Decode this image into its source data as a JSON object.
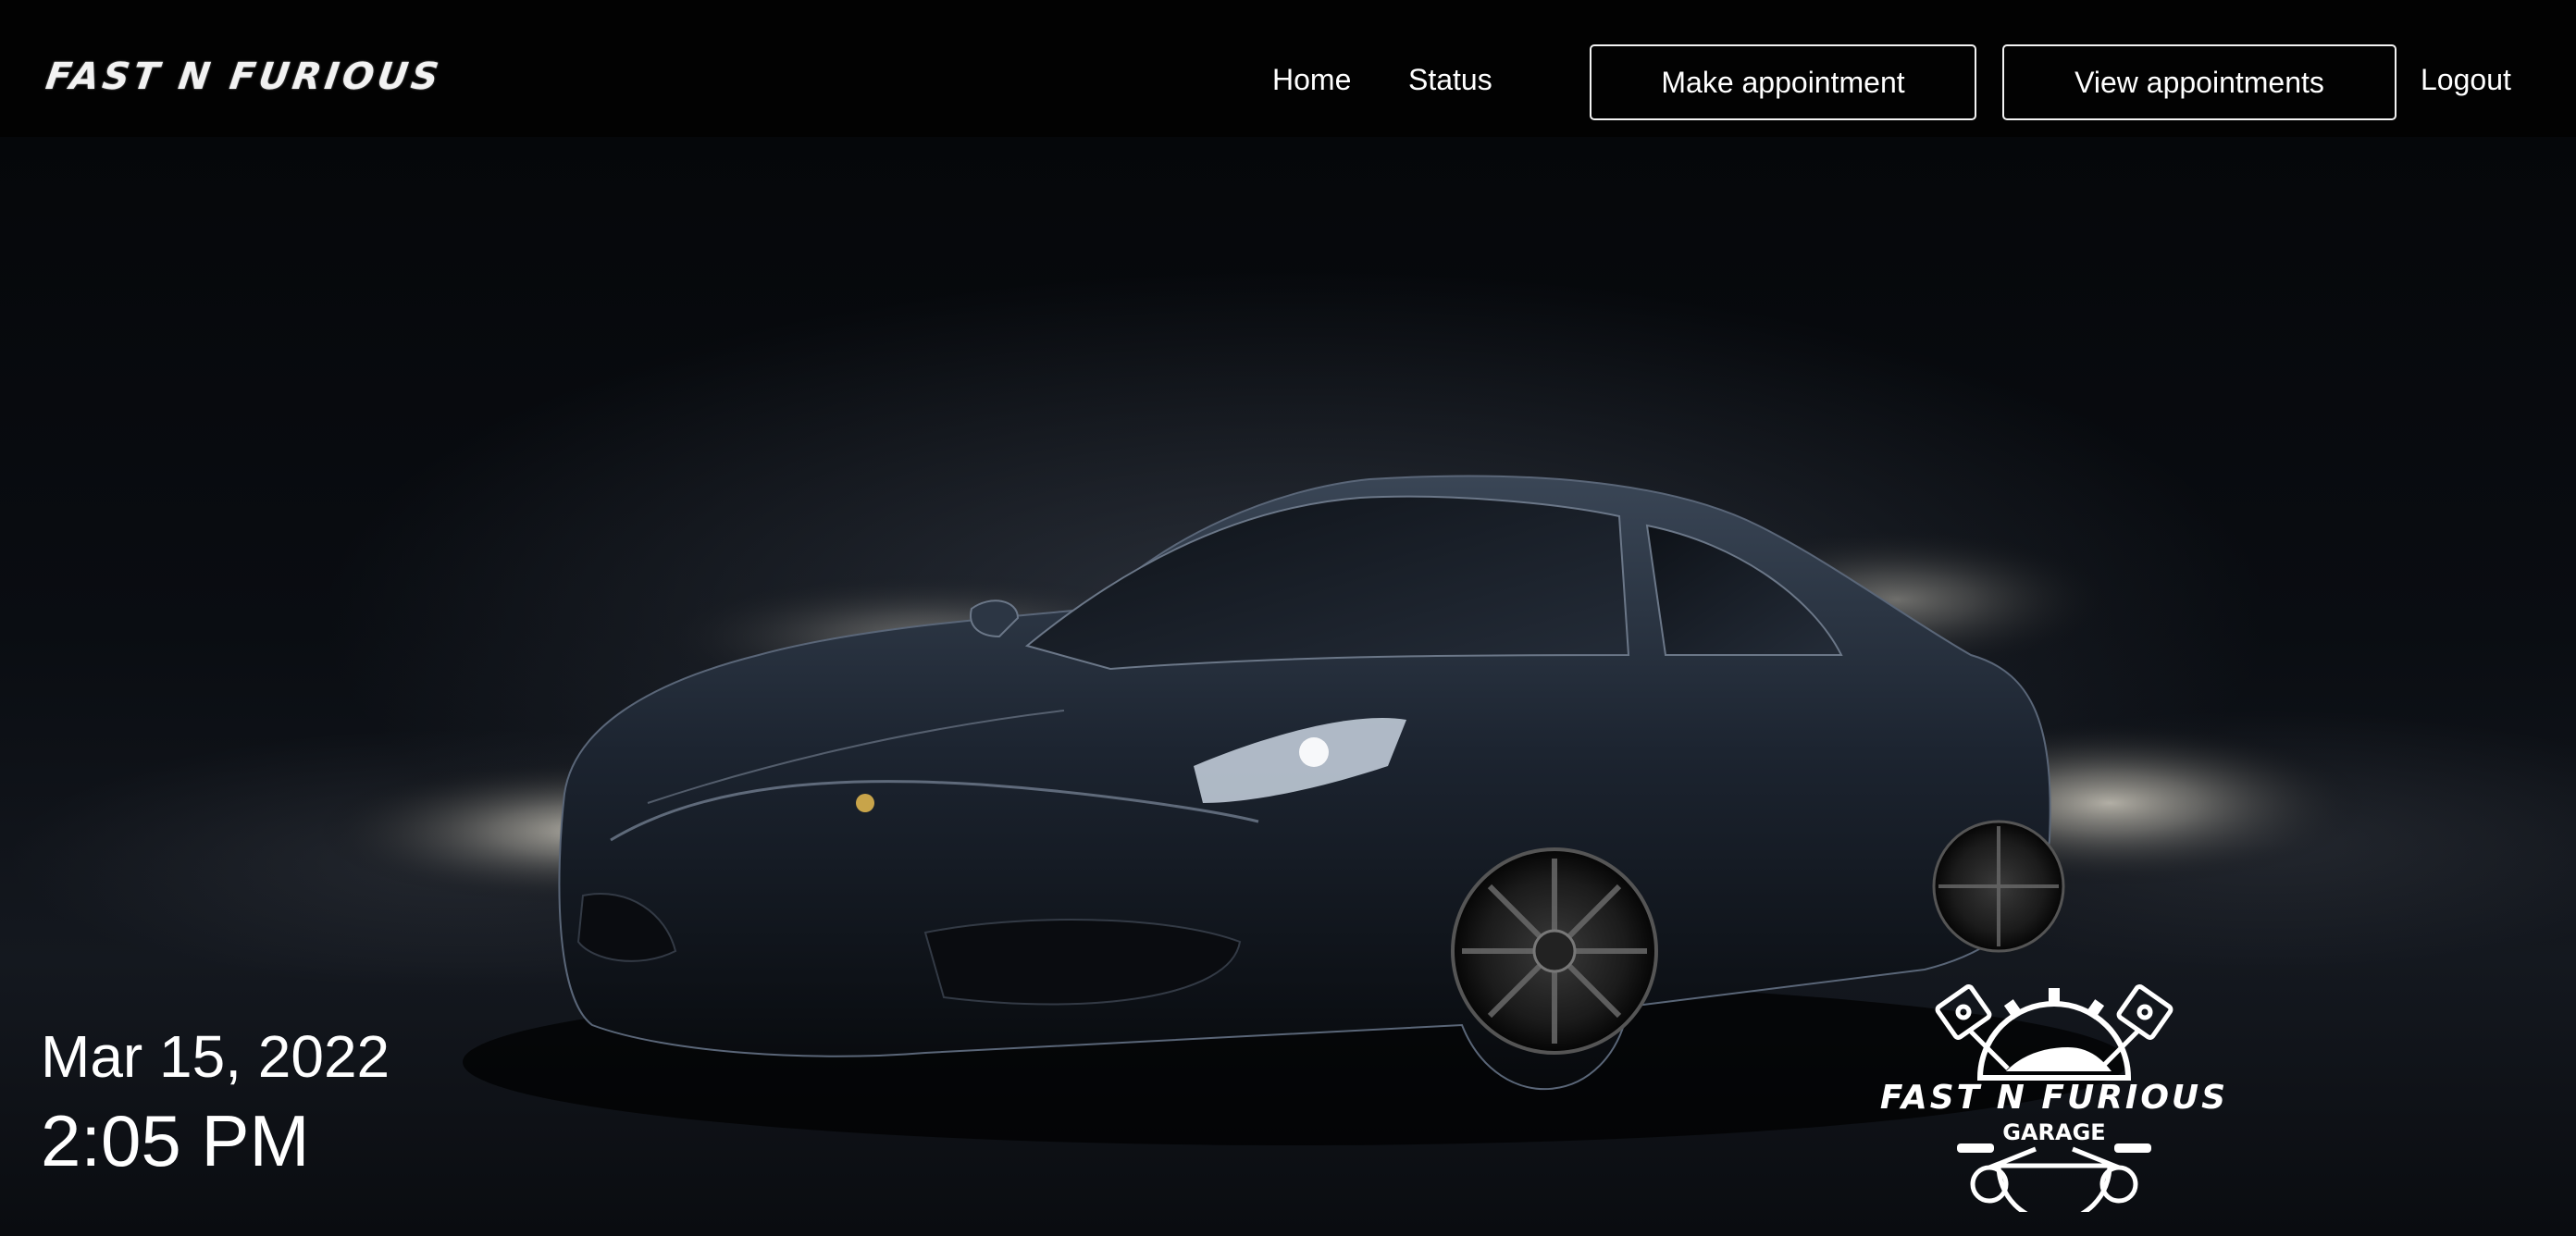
{
  "navbar": {
    "brand": "FAST N FURIOUS",
    "links": {
      "home": "Home",
      "status": "Status",
      "logout": "Logout"
    },
    "buttons": {
      "make_appointment": "Make appointment",
      "view_appointments": "View appointments"
    }
  },
  "hero": {
    "date": "Mar 15, 2022",
    "time": "2:05 PM",
    "garage_logo": {
      "title": "FAST N FURIOUS",
      "subtitle": "GARAGE",
      "icon": "pistons-gear-icon"
    },
    "background_image": "sports-car-image"
  },
  "colors": {
    "navbar_bg": "#020202",
    "text": "#ffffff",
    "button_border": "#f3f3f3",
    "car_body": "#1c2430"
  }
}
